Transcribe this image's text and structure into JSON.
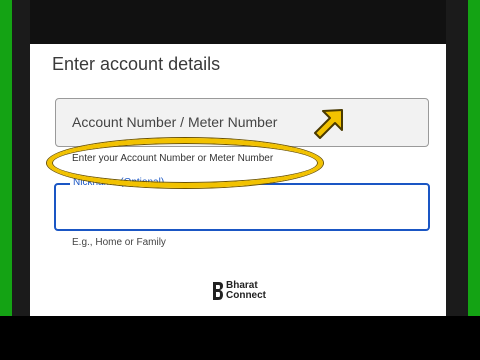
{
  "page": {
    "title": "Enter account details"
  },
  "account_field": {
    "placeholder": "Account Number / Meter Number",
    "helper": "Enter your Account Number or Meter Number"
  },
  "nickname_field": {
    "label": "Nickname (Optional)",
    "value": "",
    "helper": "E.g., Home or Family"
  },
  "logo": {
    "line1": "Bharat",
    "line2": "Connect"
  },
  "annotation": {
    "highlight_color": "#f2c200",
    "arrow_color": "#f2c200",
    "icon": "pointer-arrow-icon"
  },
  "colors": {
    "accent": "#1a56c4",
    "side_strip": "#14a314"
  }
}
